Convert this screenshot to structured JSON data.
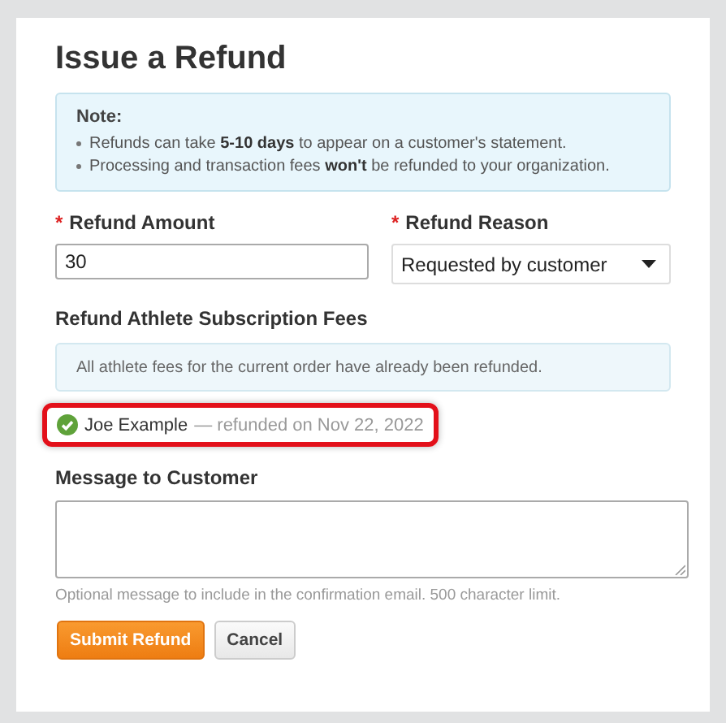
{
  "title": "Issue a Refund",
  "note": {
    "heading": "Note:",
    "items": [
      "Refunds can take **5-10 days** to appear on a customer's statement.",
      "Processing and transaction fees **won't** be refunded to your organization."
    ]
  },
  "fields": [
    {
      "kind": "input",
      "marker": "*",
      "label": "Refund Amount",
      "value": "30"
    },
    {
      "kind": "select",
      "marker": "*",
      "label": "Refund Reason",
      "value": "Requested by customer"
    }
  ],
  "fees": {
    "heading": "Refund Athlete Subscription Fees",
    "info": "All athlete fees for the current order have already been refunded.",
    "records": [
      {
        "name": "Joe Example",
        "detail": "— refunded on Nov 22, 2022",
        "refunded": true,
        "highlighted": true
      }
    ]
  },
  "message": {
    "label": "Message to Customer",
    "help": "Optional message to include in the confirmation email. 500 character limit."
  },
  "buttons": [
    {
      "kind": "primary",
      "label": "Submit Refund"
    },
    {
      "kind": "secondary",
      "label": "Cancel"
    }
  ]
}
